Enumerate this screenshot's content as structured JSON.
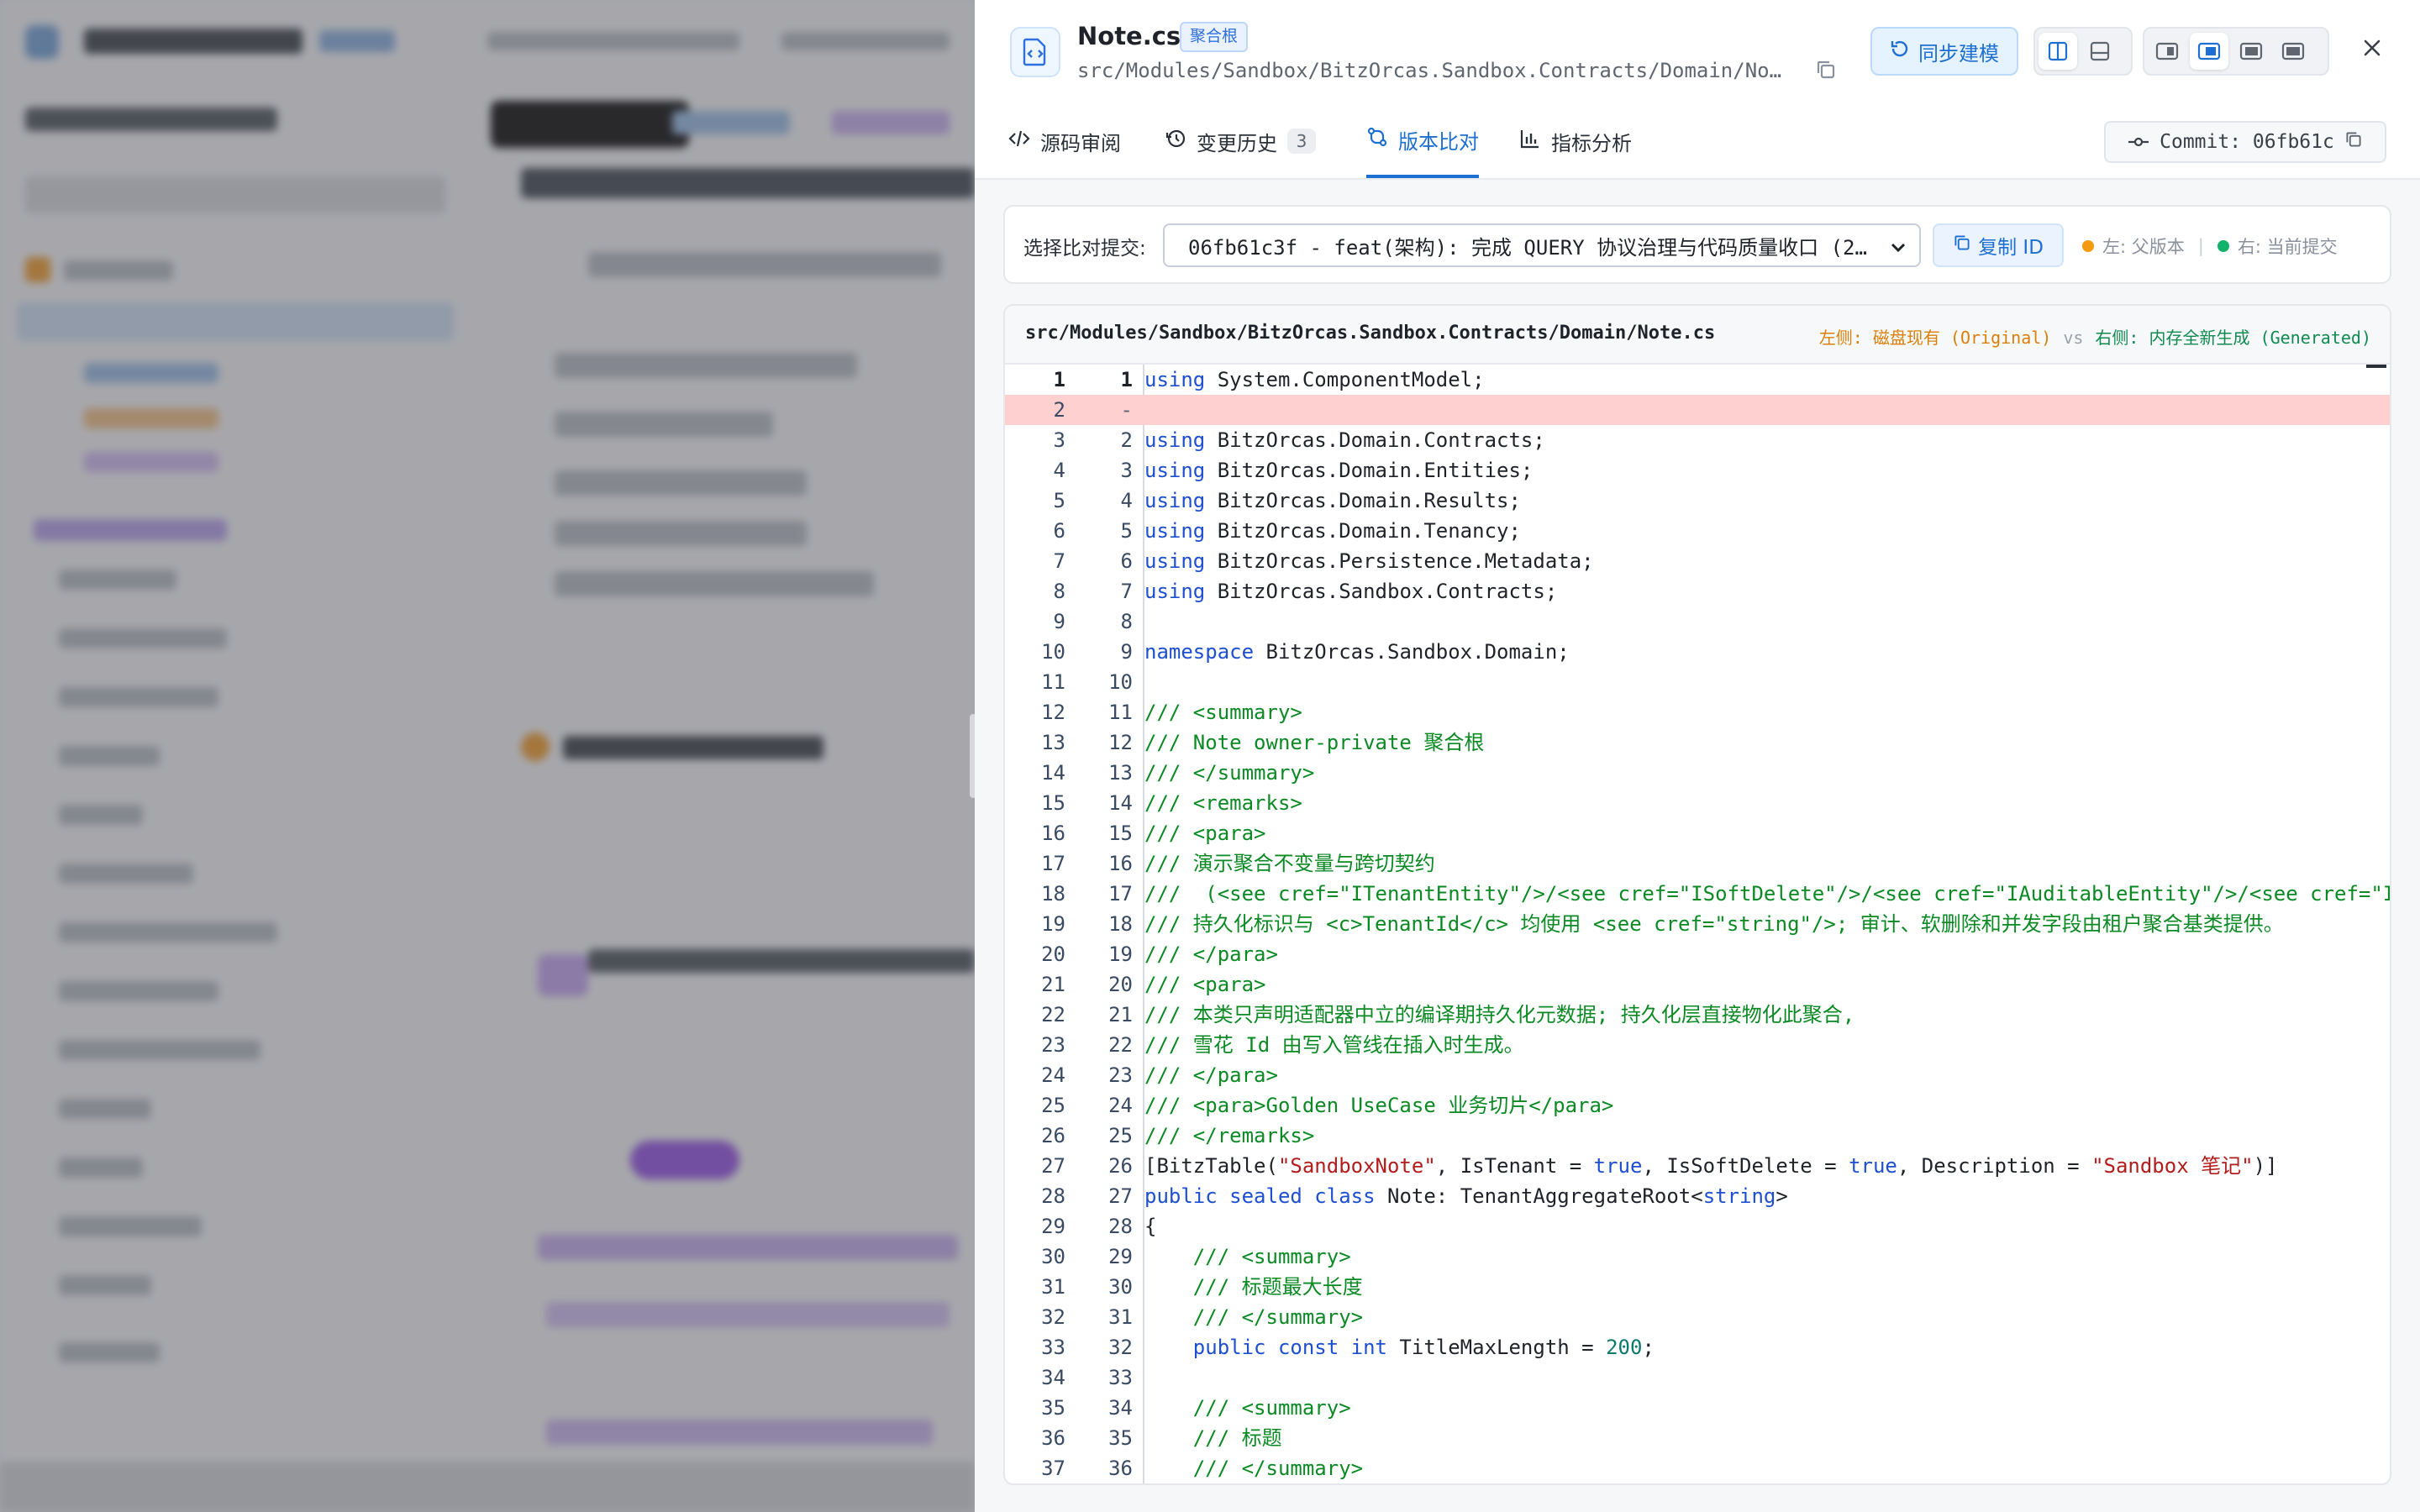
{
  "drawer": {
    "file_name": "Note.cs",
    "badge": "聚合根",
    "file_path": "src/Modules/Sandbox/BitzOrcas.Sandbox.Contracts/Domain/Note.cs",
    "sync_label": "同步建模",
    "icons": [
      "file-code-icon",
      "copy-icon",
      "refresh-icon",
      "layout-split-icon",
      "layout-bottom-icon",
      "panel-left-icon",
      "panel-center-icon",
      "panel-wide-icon",
      "panel-full-icon",
      "close-icon"
    ],
    "colors": {
      "accent": "#1e6fd2",
      "deleted_bg": "#ffd0d0",
      "keyword": "#1d4fd1",
      "comment": "#0b8a24",
      "string": "#b31c1c",
      "left_legend": "#f39a0e",
      "right_legend": "#12b26a"
    }
  },
  "tabs": [
    {
      "label": "源码审阅",
      "icon": "code-icon"
    },
    {
      "label": "变更历史",
      "icon": "history-icon",
      "count": "3"
    },
    {
      "label": "版本比对",
      "icon": "compare-icon",
      "active": true
    },
    {
      "label": "指标分析",
      "icon": "chart-icon"
    }
  ],
  "commit": {
    "label": "Commit: 06fb61c"
  },
  "compare": {
    "label": "选择比对提交:",
    "selected": "06fb61c3f - feat(架构): 完成 QUERY 协议治理与代码质量收口 (2...",
    "copy_id": "复制 ID",
    "legend_left": "左: 父版本",
    "legend_sep": "|",
    "legend_right": "右: 当前提交"
  },
  "diff": {
    "path": "src/Modules/Sandbox/BitzOrcas.Sandbox.Contracts/Domain/Note.cs",
    "left_label": "左侧: 磁盘现有 (Original)",
    "vs": "vs",
    "right_label": "右侧: 内存全新生成 (Generated)",
    "lines": [
      {
        "l": "1",
        "r": "1",
        "h": "<span class=\"kw\">using</span> System.ComponentModel;"
      },
      {
        "l": "2",
        "r": "-",
        "h": "",
        "del": true
      },
      {
        "l": "3",
        "r": "2",
        "h": "<span class=\"kw\">using</span> BitzOrcas.Domain.Contracts;"
      },
      {
        "l": "4",
        "r": "3",
        "h": "<span class=\"kw\">using</span> BitzOrcas.Domain.Entities;"
      },
      {
        "l": "5",
        "r": "4",
        "h": "<span class=\"kw\">using</span> BitzOrcas.Domain.Results;"
      },
      {
        "l": "6",
        "r": "5",
        "h": "<span class=\"kw\">using</span> BitzOrcas.Domain.Tenancy;"
      },
      {
        "l": "7",
        "r": "6",
        "h": "<span class=\"kw\">using</span> BitzOrcas.Persistence.Metadata;"
      },
      {
        "l": "8",
        "r": "7",
        "h": "<span class=\"kw\">using</span> BitzOrcas.Sandbox.Contracts;"
      },
      {
        "l": "9",
        "r": "8",
        "h": ""
      },
      {
        "l": "10",
        "r": "9",
        "h": "<span class=\"kw\">namespace</span> BitzOrcas.Sandbox.Domain;"
      },
      {
        "l": "11",
        "r": "10",
        "h": ""
      },
      {
        "l": "12",
        "r": "11",
        "h": "<span class=\"cm\">/// &lt;summary&gt;</span>"
      },
      {
        "l": "13",
        "r": "12",
        "h": "<span class=\"cm\">/// Note owner-private 聚合根</span>"
      },
      {
        "l": "14",
        "r": "13",
        "h": "<span class=\"cm\">/// &lt;/summary&gt;</span>"
      },
      {
        "l": "15",
        "r": "14",
        "h": "<span class=\"cm\">/// &lt;remarks&gt;</span>"
      },
      {
        "l": "16",
        "r": "15",
        "h": "<span class=\"cm\">/// &lt;para&gt;</span>"
      },
      {
        "l": "17",
        "r": "16",
        "h": "<span class=\"cm\">/// 演示聚合不变量与跨切契约</span>"
      },
      {
        "l": "18",
        "r": "17",
        "h": "<span class=\"cm\">///  (&lt;see cref=\"ITenantEntity\"/&gt;/&lt;see cref=\"ISoftDelete\"/&gt;/&lt;see cref=\"IAuditableEntity\"/&gt;/&lt;see cref=\"IConcurrencyStamp\"/&gt;)</span>"
      },
      {
        "l": "19",
        "r": "18",
        "h": "<span class=\"cm\">/// 持久化标识与 &lt;c&gt;TenantId&lt;/c&gt; 均使用 &lt;see cref=\"string\"/&gt;; 审计、软删除和并发字段由租户聚合基类提供。</span>"
      },
      {
        "l": "20",
        "r": "19",
        "h": "<span class=\"cm\">/// &lt;/para&gt;</span>"
      },
      {
        "l": "21",
        "r": "20",
        "h": "<span class=\"cm\">/// &lt;para&gt;</span>"
      },
      {
        "l": "22",
        "r": "21",
        "h": "<span class=\"cm\">/// 本类只声明适配器中立的编译期持久化元数据; 持久化层直接物化此聚合,</span>"
      },
      {
        "l": "23",
        "r": "22",
        "h": "<span class=\"cm\">/// 雪花 Id 由写入管线在插入时生成。</span>"
      },
      {
        "l": "24",
        "r": "23",
        "h": "<span class=\"cm\">/// &lt;/para&gt;</span>"
      },
      {
        "l": "25",
        "r": "24",
        "h": "<span class=\"cm\">/// &lt;para&gt;Golden UseCase 业务切片&lt;/para&gt;</span>"
      },
      {
        "l": "26",
        "r": "25",
        "h": "<span class=\"cm\">/// &lt;/remarks&gt;</span>"
      },
      {
        "l": "27",
        "r": "26",
        "h": "[BitzTable(<span class=\"st\">\"SandboxNote\"</span>, IsTenant = <span class=\"kw\">true</span>, IsSoftDelete = <span class=\"kw\">true</span>, Description = <span class=\"st\">\"Sandbox 笔记\"</span>)]"
      },
      {
        "l": "28",
        "r": "27",
        "h": "<span class=\"kw\">public sealed class</span> Note: TenantAggregateRoot&lt;<span class=\"kw\">string</span>&gt;"
      },
      {
        "l": "29",
        "r": "28",
        "h": "{"
      },
      {
        "l": "30",
        "r": "29",
        "h": "    <span class=\"cm\">/// &lt;summary&gt;</span>"
      },
      {
        "l": "31",
        "r": "30",
        "h": "    <span class=\"cm\">/// 标题最大长度</span>"
      },
      {
        "l": "32",
        "r": "31",
        "h": "    <span class=\"cm\">/// &lt;/summary&gt;</span>"
      },
      {
        "l": "33",
        "r": "32",
        "h": "    <span class=\"kw\">public const int</span> TitleMaxLength = <span class=\"nm\">200</span>;"
      },
      {
        "l": "34",
        "r": "33",
        "h": ""
      },
      {
        "l": "35",
        "r": "34",
        "h": "    <span class=\"cm\">/// &lt;summary&gt;</span>"
      },
      {
        "l": "36",
        "r": "35",
        "h": "    <span class=\"cm\">/// 标题</span>"
      },
      {
        "l": "37",
        "r": "36",
        "h": "    <span class=\"cm\">/// &lt;/summary&gt;</span>"
      }
    ]
  }
}
